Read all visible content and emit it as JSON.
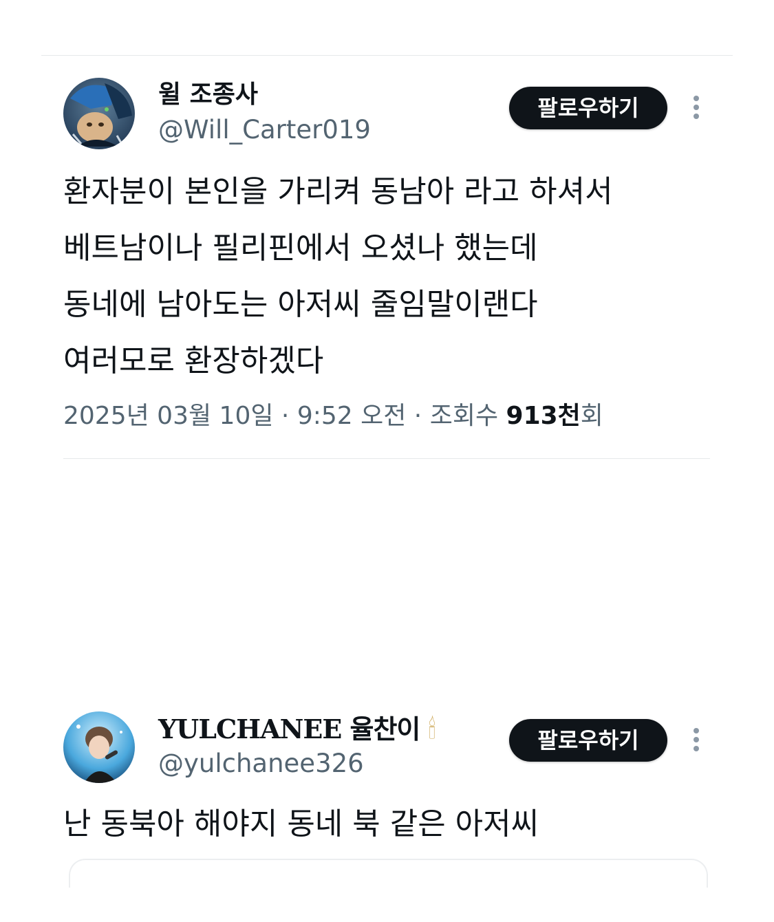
{
  "tweets": [
    {
      "display_name": "윌 조종사",
      "handle": "@Will_Carter019",
      "follow_label": "팔로우하기",
      "more_icon": "more-vertical-icon",
      "body_lines": "환자분이 본인을 가리켜 동남아 라고 하셔서\n베트남이나 필리핀에서 오셨나 했는데\n동네에 남아도는 아저씨 줄임말이랜다\n여러모로 환장하겠다",
      "date": "2025년 03월 10일",
      "separator": " · ",
      "time": "9:52 오전",
      "views_prefix": "조회수 ",
      "views_count": "913천",
      "views_suffix": "회"
    },
    {
      "display_name": "YULCHANEE 율찬이",
      "name_emoji": "🕯",
      "handle": "@yulchanee326",
      "follow_label": "팔로우하기",
      "more_icon": "more-vertical-icon",
      "body_lines": "난 동북아 해야지 동네 북 같은 아저씨"
    }
  ],
  "colors": {
    "text_primary": "#0f1419",
    "text_secondary": "#536471",
    "divider": "#e6e8ea",
    "button_bg": "#0f1419",
    "button_text": "#ffffff"
  }
}
